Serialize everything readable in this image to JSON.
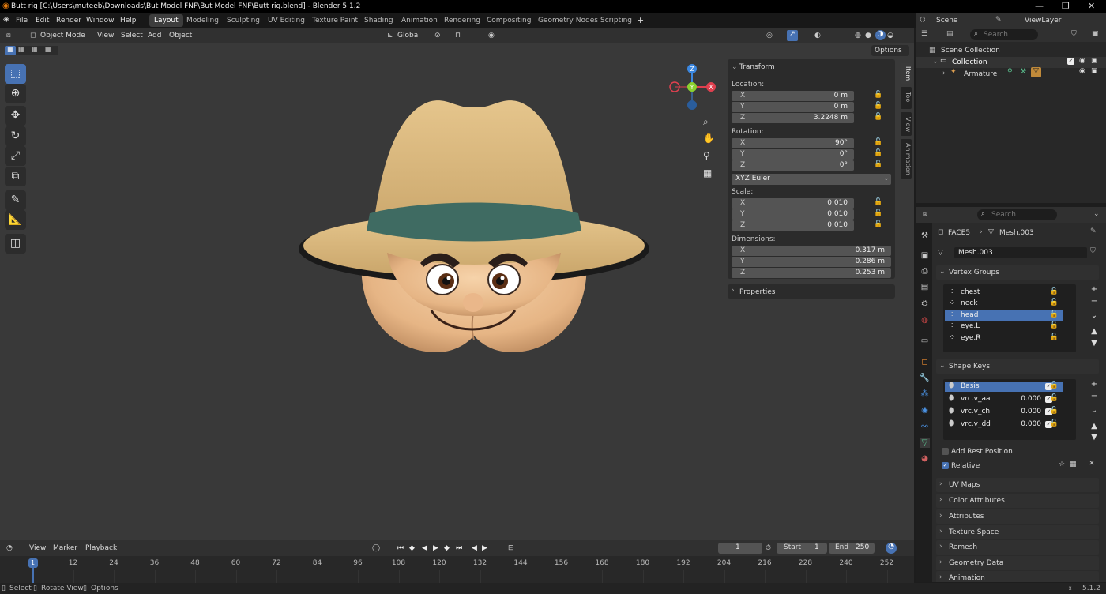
{
  "window": {
    "title": "Butt rig [C:\\Users\\muteeb\\Downloads\\But Model FNF\\But Model FNF\\Butt rig.blend] - Blender 5.1.2",
    "min": "—",
    "max": "❐",
    "close": "✕"
  },
  "menu": [
    "File",
    "Edit",
    "Render",
    "Window",
    "Help"
  ],
  "workspaces": [
    "Layout",
    "Modeling",
    "Sculpting",
    "UV Editing",
    "Texture Paint",
    "Shading",
    "Animation",
    "Rendering",
    "Compositing",
    "Geometry Nodes",
    "Scripting"
  ],
  "workspace_add": "+",
  "scene": {
    "name": "Scene",
    "view_layer": "ViewLayer"
  },
  "viewport_header": {
    "mode": "Object Mode",
    "menus": [
      "View",
      "Select",
      "Add",
      "Object"
    ],
    "orientation": "Global",
    "options": "Options"
  },
  "gizmo": {
    "z": "Z",
    "y": "Y",
    "x": "X"
  },
  "npanel": {
    "transform_title": "Transform",
    "location_label": "Location:",
    "location": [
      {
        "axis": "X",
        "value": "0 m"
      },
      {
        "axis": "Y",
        "value": "0 m"
      },
      {
        "axis": "Z",
        "value": "3.2248 m"
      }
    ],
    "rotation_label": "Rotation:",
    "rotation": [
      {
        "axis": "X",
        "value": "90°"
      },
      {
        "axis": "Y",
        "value": "0°"
      },
      {
        "axis": "Z",
        "value": "0°"
      }
    ],
    "rotation_mode": "XYZ Euler",
    "scale_label": "Scale:",
    "scale": [
      {
        "axis": "X",
        "value": "0.010"
      },
      {
        "axis": "Y",
        "value": "0.010"
      },
      {
        "axis": "Z",
        "value": "0.010"
      }
    ],
    "dimensions_label": "Dimensions:",
    "dimensions": [
      {
        "axis": "X",
        "value": "0.317 m"
      },
      {
        "axis": "Y",
        "value": "0.286 m"
      },
      {
        "axis": "Z",
        "value": "0.253 m"
      }
    ],
    "properties_title": "Properties"
  },
  "sidebar_tabs": [
    "Item",
    "Tool",
    "View",
    "Animation"
  ],
  "outliner": {
    "search_placeholder": "Search",
    "scene_collection": "Scene Collection",
    "collection": "Collection",
    "armature": "Armature"
  },
  "properties": {
    "search_placeholder": "Search",
    "breadcrumb_object": "FACE5",
    "breadcrumb_mesh": "Mesh.003",
    "mesh_name": "Mesh.003",
    "vertex_groups_title": "Vertex Groups",
    "vertex_groups": [
      "chest",
      "neck",
      "head",
      "eye.L",
      "eye.R"
    ],
    "selected_vertex_group": "head",
    "shape_keys_title": "Shape Keys",
    "shape_keys": [
      {
        "name": "Basis",
        "value": ""
      },
      {
        "name": "vrc.v_aa",
        "value": "0.000"
      },
      {
        "name": "vrc.v_ch",
        "value": "0.000"
      },
      {
        "name": "vrc.v_dd",
        "value": "0.000"
      }
    ],
    "add_rest_position": "Add Rest Position",
    "relative": "Relative",
    "collapsed_sections": [
      "UV Maps",
      "Color Attributes",
      "Attributes",
      "Texture Space",
      "Remesh",
      "Geometry Data",
      "Animation"
    ]
  },
  "timeline": {
    "menus": [
      "View",
      "Marker",
      "Playback"
    ],
    "current_frame": "1",
    "start_label": "Start",
    "start": "1",
    "end_label": "End",
    "end": "250",
    "ticks": [
      "1",
      "12",
      "24",
      "36",
      "48",
      "60",
      "72",
      "84",
      "96",
      "108",
      "120",
      "132",
      "144",
      "156",
      "168",
      "180",
      "192",
      "204",
      "216",
      "228",
      "240",
      "252"
    ]
  },
  "status": {
    "select": "Select",
    "rotate": "Rotate View",
    "options": "Options",
    "version": "5.1.2"
  }
}
